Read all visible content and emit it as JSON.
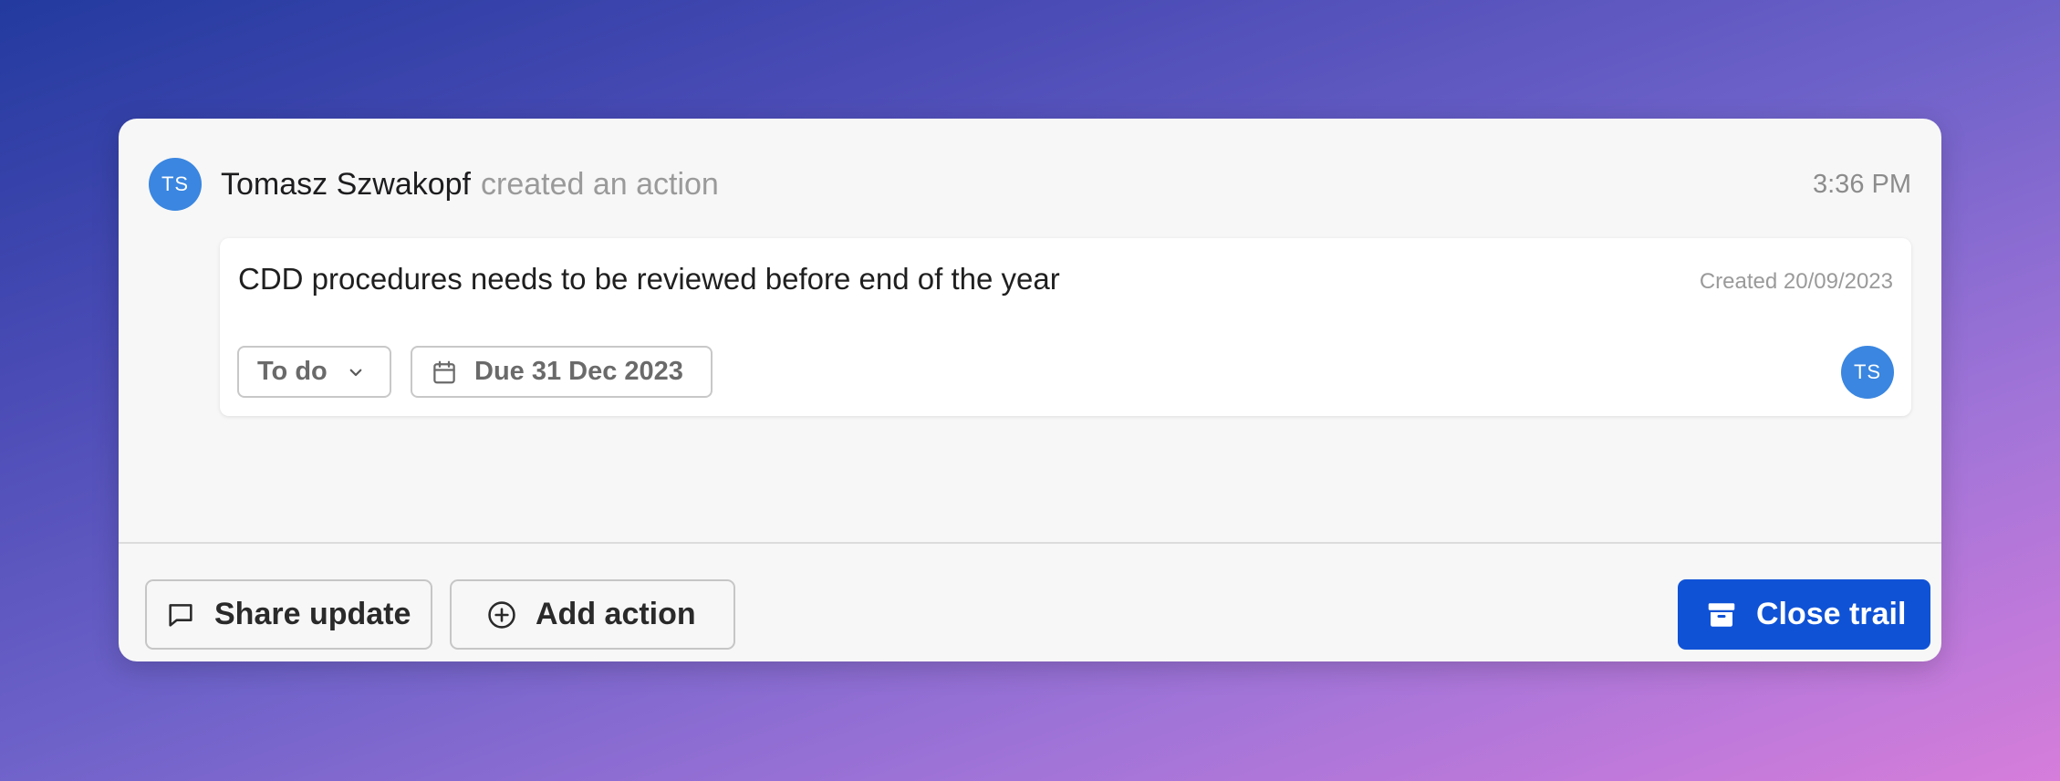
{
  "activity": {
    "avatar_initials": "TS",
    "author": "Tomasz Szwakopf",
    "verb": "created an action",
    "time": "3:36 PM"
  },
  "action": {
    "title": "CDD procedures needs to be reviewed before end of the year",
    "created": "Created 20/09/2023",
    "status": "To do",
    "due": "Due 31 Dec 2023",
    "assignee_initials": "TS"
  },
  "footer": {
    "share_label": "Share update",
    "add_label": "Add action",
    "close_label": "Close trail"
  },
  "colors": {
    "avatar": "#3a86e0",
    "primary_button": "#0f52d6",
    "card_background": "#f7f7f7"
  },
  "icons": {
    "status_dropdown": "chevron-down-icon",
    "due_date": "calendar-icon",
    "share": "speech-bubble-icon",
    "add": "plus-circle-icon",
    "close": "archive-box-icon"
  }
}
